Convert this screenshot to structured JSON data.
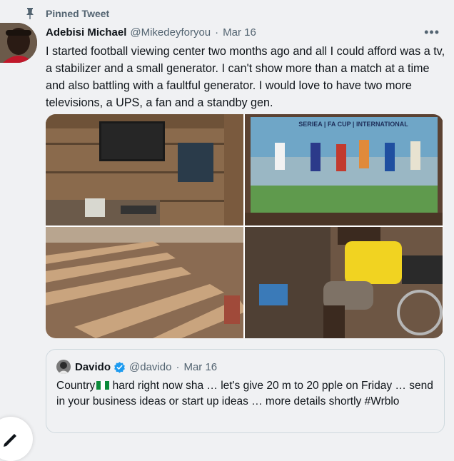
{
  "pinned": {
    "label": "Pinned Tweet",
    "icon": "pin-icon"
  },
  "tweet": {
    "author_name": "Adebisi Michael",
    "handle": "@Mikedeyforyou",
    "separator": "·",
    "date": "Mar 16",
    "text": "I started football viewing center two months ago and all I could afford was a tv, a stabilizer and a small generator. I can't show more than a match at a time and also battling with a faultful generator. I would love to have two more televisions, a UPS, a fan and a standby gen.",
    "more_icon": "more-horizontal-icon",
    "poster_text": "SERIEA | FA CUP | INTERNATIONAL"
  },
  "quote": {
    "author_name": "Davido",
    "handle": "@davido",
    "separator": "·",
    "date": "Mar 16",
    "text_before_flag": "Country",
    "text_after_flag": " hard right now sha … let's give 20 m to 20 pple on Friday … send in your business ideas or start up ideas … more details shortly #Wrblo",
    "verified_icon": "verified-badge-icon",
    "flag_icon": "nigeria-flag-icon"
  },
  "colors": {
    "background": "#f0f1f3",
    "text": "#0f1419",
    "secondary_text": "#536471",
    "verified": "#1d9bf0"
  }
}
